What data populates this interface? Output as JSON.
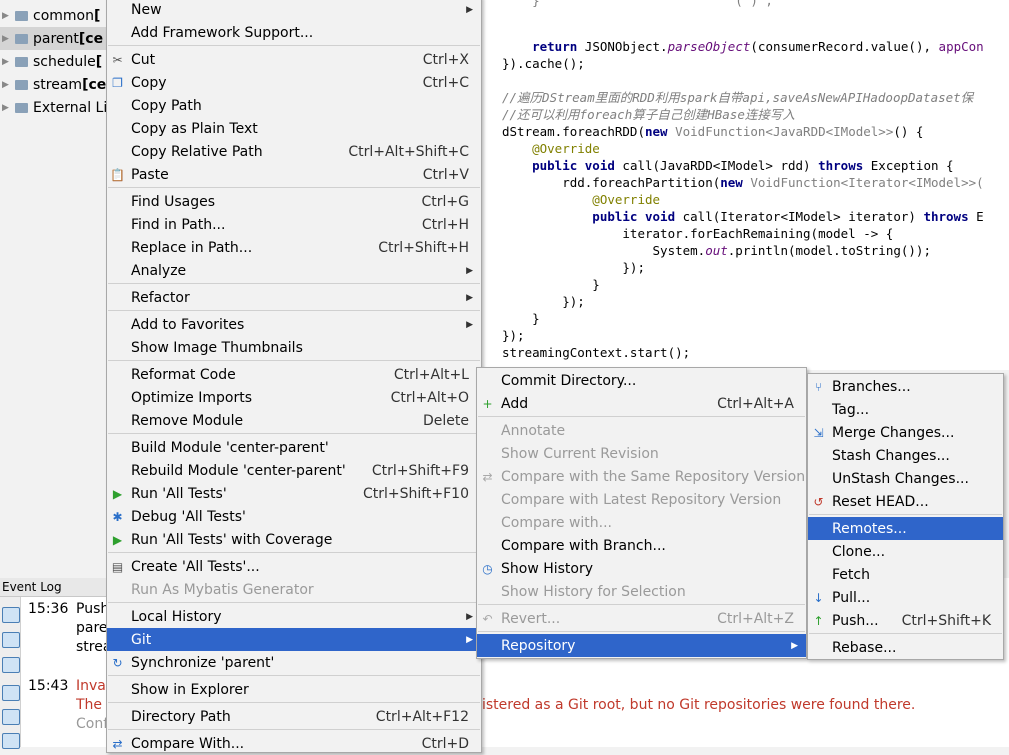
{
  "project_tree": [
    {
      "name": "common",
      "suffix": "[",
      "selected": false
    },
    {
      "name": "parent",
      "suffix": "[ce",
      "selected": true
    },
    {
      "name": "schedule",
      "suffix": "[",
      "selected": false
    },
    {
      "name": "stream",
      "suffix": "[ce",
      "selected": false
    },
    {
      "name": "External Li",
      "suffix": "",
      "selected": false
    }
  ],
  "editor": {
    "lines": [
      "    return JSONObject.parseObject(consumerRecord.value(), appCon",
      "}).cache();",
      "//遍历DStream里面的RDD利用spark自带api,saveAsNewAPIHadoopDataset保",
      "//还可以利用foreach算子自己创建HBase连接写入",
      "dStream.foreachRDD(new VoidFunction<JavaRDD<IModel>>() {",
      "    @Override",
      "    public void call(JavaRDD<IModel> rdd) throws Exception {",
      "        rdd.foreachPartition(new VoidFunction<Iterator<IModel>>(",
      "            @Override",
      "            public void call(Iterator<IModel> iterator) throws E",
      "                iterator.forEachRemaining(model -> {",
      "                    System.out.println(model.toString());",
      "                });",
      "            }",
      "        });",
      "    }",
      "});",
      "streamingContext.start();"
    ]
  },
  "event_log": {
    "tab_label": "Event Log",
    "entries": [
      {
        "time": "15:36",
        "lines": [
          "Push",
          "pare",
          "strea"
        ],
        "error": false
      },
      {
        "time": "15:43",
        "lines": [
          "Inval",
          "The",
          "Conf"
        ],
        "error": true
      }
    ],
    "error_message": "istered as a Git root, but no Git repositories were found there."
  },
  "context_menu": {
    "items": [
      {
        "label": "New",
        "shortcut": "",
        "submenu": true
      },
      {
        "label": "Add Framework Support...",
        "shortcut": ""
      },
      {
        "sep": true
      },
      {
        "label": "Cut",
        "shortcut": "Ctrl+X",
        "icon": "scissors-icon"
      },
      {
        "label": "Copy",
        "shortcut": "Ctrl+C",
        "icon": "copy-icon"
      },
      {
        "label": "Copy Path",
        "shortcut": ""
      },
      {
        "label": "Copy as Plain Text",
        "shortcut": ""
      },
      {
        "label": "Copy Relative Path",
        "shortcut": "Ctrl+Alt+Shift+C"
      },
      {
        "label": "Paste",
        "shortcut": "Ctrl+V",
        "icon": "paste-icon"
      },
      {
        "sep": true
      },
      {
        "label": "Find Usages",
        "shortcut": "Ctrl+G"
      },
      {
        "label": "Find in Path...",
        "shortcut": "Ctrl+H"
      },
      {
        "label": "Replace in Path...",
        "shortcut": "Ctrl+Shift+H"
      },
      {
        "label": "Analyze",
        "shortcut": "",
        "submenu": true
      },
      {
        "sep": true
      },
      {
        "label": "Refactor",
        "shortcut": "",
        "submenu": true
      },
      {
        "sep": true
      },
      {
        "label": "Add to Favorites",
        "shortcut": "",
        "submenu": true
      },
      {
        "label": "Show Image Thumbnails",
        "shortcut": ""
      },
      {
        "sep": true
      },
      {
        "label": "Reformat Code",
        "shortcut": "Ctrl+Alt+L"
      },
      {
        "label": "Optimize Imports",
        "shortcut": "Ctrl+Alt+O"
      },
      {
        "label": "Remove Module",
        "shortcut": "Delete"
      },
      {
        "sep": true
      },
      {
        "label": "Build Module 'center-parent'",
        "shortcut": ""
      },
      {
        "label": "Rebuild Module 'center-parent'",
        "shortcut": "Ctrl+Shift+F9"
      },
      {
        "label": "Run 'All Tests'",
        "shortcut": "Ctrl+Shift+F10",
        "icon": "run-icon"
      },
      {
        "label": "Debug 'All Tests'",
        "shortcut": "",
        "icon": "debug-icon"
      },
      {
        "label": "Run 'All Tests' with Coverage",
        "shortcut": "",
        "icon": "coverage-icon"
      },
      {
        "sep": true
      },
      {
        "label": "Create 'All Tests'...",
        "shortcut": "",
        "icon": "create-config-icon"
      },
      {
        "label": "Run As Mybatis Generator",
        "shortcut": "",
        "disabled": true
      },
      {
        "sep": true
      },
      {
        "label": "Local History",
        "shortcut": "",
        "submenu": true
      },
      {
        "label": "Git",
        "shortcut": "",
        "submenu": true,
        "highlighted": true
      },
      {
        "label": "Synchronize 'parent'",
        "shortcut": "",
        "icon": "sync-icon"
      },
      {
        "sep": true
      },
      {
        "label": "Show in Explorer",
        "shortcut": ""
      },
      {
        "sep": true
      },
      {
        "label": "Directory Path",
        "shortcut": "Ctrl+Alt+F12"
      },
      {
        "sep": true
      },
      {
        "label": "Compare With...",
        "shortcut": "Ctrl+D",
        "icon": "compare-icon"
      }
    ]
  },
  "git_menu": {
    "items": [
      {
        "label": "Commit Directory...",
        "shortcut": ""
      },
      {
        "label": "Add",
        "shortcut": "Ctrl+Alt+A",
        "icon": "plus-icon"
      },
      {
        "sep": true
      },
      {
        "label": "Annotate",
        "shortcut": "",
        "disabled": true
      },
      {
        "label": "Show Current Revision",
        "shortcut": "",
        "disabled": true
      },
      {
        "label": "Compare with the Same Repository Version",
        "shortcut": "",
        "disabled": true,
        "icon": "compare-icon"
      },
      {
        "label": "Compare with Latest Repository Version",
        "shortcut": "",
        "disabled": true
      },
      {
        "label": "Compare with...",
        "shortcut": "",
        "disabled": true
      },
      {
        "label": "Compare with Branch...",
        "shortcut": ""
      },
      {
        "label": "Show History",
        "shortcut": "",
        "icon": "history-icon"
      },
      {
        "label": "Show History for Selection",
        "shortcut": "",
        "disabled": true
      },
      {
        "sep": true
      },
      {
        "label": "Revert...",
        "shortcut": "Ctrl+Alt+Z",
        "disabled": true,
        "icon": "revert-icon"
      },
      {
        "sep": true
      },
      {
        "label": "Repository",
        "shortcut": "",
        "submenu": true,
        "highlighted": true
      }
    ]
  },
  "repository_menu": {
    "items": [
      {
        "label": "Branches...",
        "shortcut": "",
        "icon": "branch-icon"
      },
      {
        "label": "Tag...",
        "shortcut": ""
      },
      {
        "label": "Merge Changes...",
        "shortcut": "",
        "icon": "merge-icon"
      },
      {
        "label": "Stash Changes...",
        "shortcut": ""
      },
      {
        "label": "UnStash Changes...",
        "shortcut": ""
      },
      {
        "label": "Reset HEAD...",
        "shortcut": "",
        "icon": "reset-icon"
      },
      {
        "sep": true
      },
      {
        "label": "Remotes...",
        "shortcut": "",
        "highlighted": true
      },
      {
        "label": "Clone...",
        "shortcut": ""
      },
      {
        "label": "Fetch",
        "shortcut": ""
      },
      {
        "label": "Pull...",
        "shortcut": "",
        "icon": "vcs-pull-icon"
      },
      {
        "label": "Push...",
        "shortcut": "Ctrl+Shift+K",
        "icon": "vcs-push-icon"
      },
      {
        "sep": true
      },
      {
        "label": "Rebase...",
        "shortcut": ""
      }
    ]
  },
  "colors": {
    "highlight": "#2f65ca",
    "error": "#c0392b",
    "keyword": "#000080",
    "annotation": "#808000",
    "comment": "#808080"
  }
}
